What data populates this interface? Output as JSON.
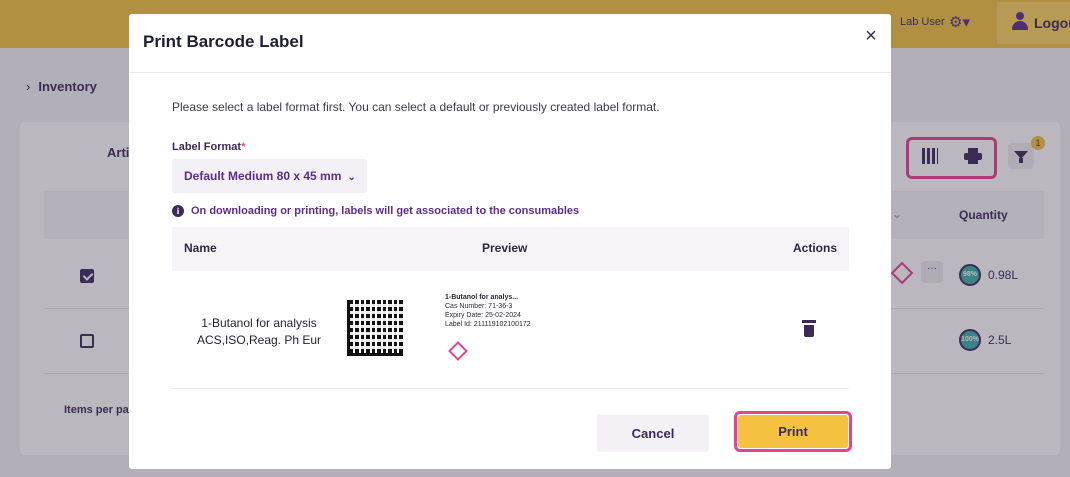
{
  "topbar": {
    "user_label": "Lab User",
    "logout_label": "Logou"
  },
  "breadcrumb": {
    "chevron": "›",
    "label": "Inventory"
  },
  "card": {
    "articles_partial": "Arti",
    "filter_badge": "1",
    "quantity_header": "Quantity",
    "more_label": "···",
    "items_per_page_partial": "Items per pa",
    "rows": [
      {
        "checked": true,
        "percent": "98%",
        "volume": "0.98L"
      },
      {
        "checked": false,
        "percent": "100%",
        "volume": "2.5L"
      }
    ]
  },
  "modal": {
    "title": "Print Barcode Label",
    "close_glyph": "×",
    "intro": "Please select a label format first. You can select a default or previously created label format.",
    "label_format_label": "Label Format",
    "required_mark": "*",
    "label_format_value": "Default Medium 80 x 45 mm",
    "dropdown_caret": "⌄",
    "info_text": "On downloading or printing, labels will get associated to the consumables",
    "table": {
      "headers": {
        "name": "Name",
        "preview": "Preview",
        "actions": "Actions"
      },
      "rows": [
        {
          "name_line1": "1-Butanol for analysis",
          "name_line2": "ACS,ISO,Reag. Ph Eur",
          "label_title": "1-Butanol for analys...",
          "label_cas": "Cas Number: 71-36-3",
          "label_expiry": "Expiry Date: 25-02-2024",
          "label_id": "Label Id: 211119102100172"
        }
      ]
    },
    "cancel_label": "Cancel",
    "print_label": "Print"
  },
  "colors": {
    "brand_yellow": "#f0c440",
    "brand_purple": "#5b2d8a",
    "highlight_pink": "#e8418f",
    "text_dark": "#3a2a5a"
  }
}
